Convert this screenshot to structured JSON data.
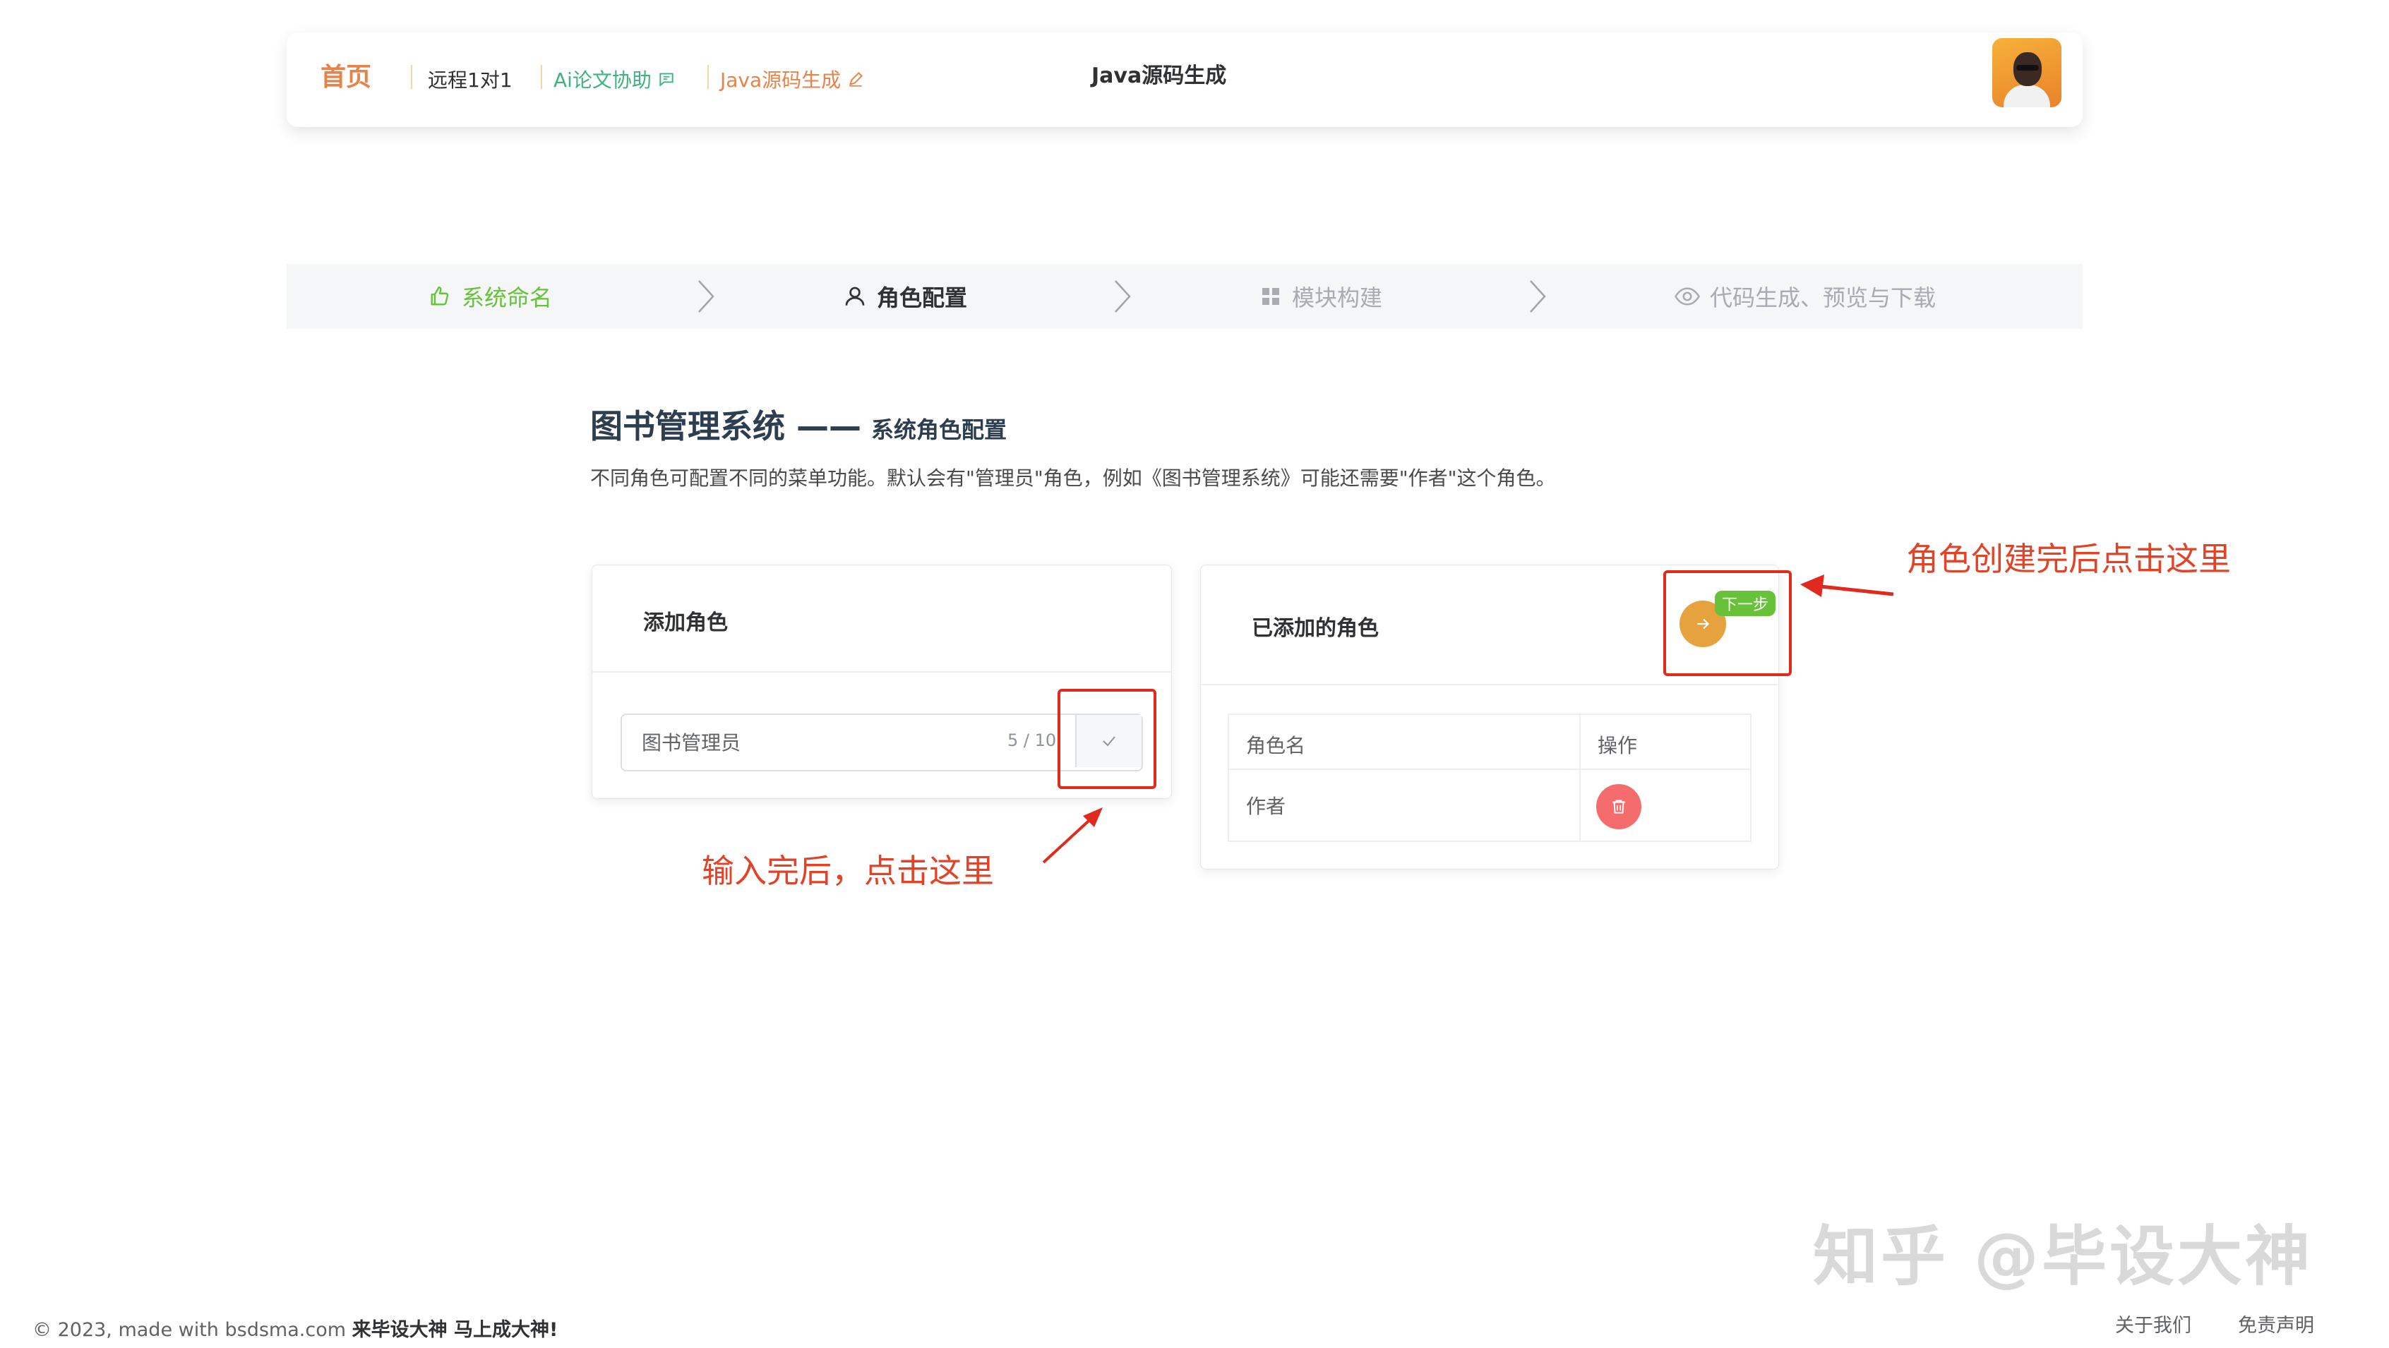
{
  "header": {
    "home": "首页",
    "nav": [
      {
        "label": "远程1对1"
      },
      {
        "label": "Ai论文协助"
      },
      {
        "label": "Java源码生成"
      }
    ],
    "center_title": "Java源码生成"
  },
  "steps": [
    {
      "label": "系统命名",
      "state": "done"
    },
    {
      "label": "角色配置",
      "state": "active"
    },
    {
      "label": "模块构建",
      "state": "pending"
    },
    {
      "label": "代码生成、预览与下载",
      "state": "pending"
    }
  ],
  "page": {
    "title": "图书管理系统 ——",
    "subtitle": "系统角色配置",
    "description": "不同角色可配置不同的菜单功能。默认会有\"管理员\"角色，例如《图书管理系统》可能还需要\"作者\"这个角色。"
  },
  "add_role": {
    "title": "添加角色",
    "input_value": "图书管理员",
    "counter": "5 / 10"
  },
  "added_roles": {
    "title": "已添加的角色",
    "next_badge": "下一步",
    "columns": [
      "角色名",
      "操作"
    ],
    "rows": [
      {
        "name": "作者"
      }
    ]
  },
  "annotations": {
    "input_hint": "输入完后，点击这里",
    "next_hint": "角色创建完后点击这里"
  },
  "footer": {
    "copyright_prefix": "© 2023, made with bsdsma.com",
    "copyright_bold": "来毕设大神 马上成大神!",
    "links": [
      "关于我们",
      "免责声明"
    ]
  },
  "watermark": "知乎 @毕设大神",
  "colors": {
    "accent_orange": "#e6834a",
    "green": "#67c23a",
    "annotation_red": "#e02a1e",
    "delete_red": "#f56c6c",
    "next_orange": "#e6a23c"
  }
}
